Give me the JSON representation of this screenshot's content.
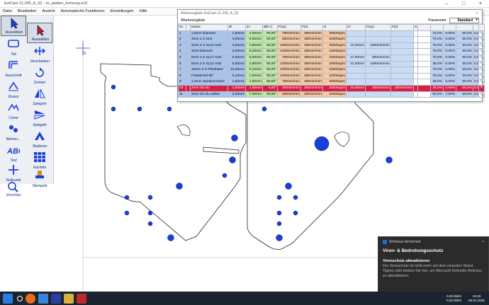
{
  "window": {
    "title": "EstCam 11.245_A_32 - xx_platten_bohrung.e10"
  },
  "menu": [
    "Datei",
    "Bearbeiten",
    "Ansicht",
    "Automatische Funktionen",
    "Einstellungen",
    "Hilfe"
  ],
  "tools": [
    {
      "label": "Auswählen",
      "icon": "select-arrow-icon"
    },
    {
      "label": "Auswählen",
      "icon": "select-arrow-icon"
    },
    {
      "label": "Teil",
      "icon": "part-icon"
    },
    {
      "label": "Verschieben",
      "icon": "move-icon"
    },
    {
      "label": "Ausschnitt",
      "icon": "cutout-icon"
    },
    {
      "label": "Drehen",
      "icon": "rotate-icon"
    },
    {
      "label": "Gravur",
      "icon": "engrave-icon"
    },
    {
      "label": "Spiegeln",
      "icon": "mirror-icon"
    },
    {
      "label": "Carve",
      "icon": "carve-icon"
    },
    {
      "label": "Spiegeln",
      "icon": "mirror-icon"
    },
    {
      "label": "Bohren...",
      "icon": "drill-icon"
    },
    {
      "label": "Skalieren",
      "icon": "scale-icon"
    },
    {
      "label": "Text",
      "icon": "text-icon"
    },
    {
      "label": "Kacheln",
      "icon": "tiles-icon"
    },
    {
      "label": "Nullpunkt",
      "icon": "origin-icon"
    },
    {
      "label": "Stempeln",
      "icon": "stamp-icon"
    },
    {
      "label": "Vorschau",
      "icon": "preview-icon"
    }
  ],
  "toolwindow": {
    "title": "Werkzeugliste EstCam 11.245_A_32",
    "subtitle": "Werkzeugliste",
    "param_label": "Parameter",
    "param_value": "Standard",
    "headers": [
      "Nr.",
      "Name",
      "Ø",
      "Z+",
      "Ø(z+)",
      "F(xy)",
      "F(z)",
      "S",
      "Z+",
      "F(xy)",
      "F(z)",
      "S",
      "",
      "",
      "",
      "",
      "",
      ""
    ],
    "rows": [
      [
        "1",
        "1,5mm Diamant",
        "1,50mm",
        "4,50mm",
        "90,00°",
        "750mm/min",
        "480mm/min",
        "30000upm",
        "",
        "",
        "",
        "",
        "75,0%",
        "0,00%",
        "50,0%",
        "0,00mm"
      ],
      [
        "2",
        "3mm 1 S SL9",
        "3,00mm",
        "6,00mm",
        "90,00°",
        "600mm/min",
        "480mm/min",
        "24000upm",
        "",
        "",
        "",
        "",
        "75,0%",
        "0,00%",
        "50,0%",
        "0,00mm"
      ],
      [
        "3",
        "3mm 2 S SL15 Holz",
        "3,00mm",
        "4,80mm",
        "90,00°",
        "1800mm/min",
        "480mm/min",
        "30000upm",
        "12,00mm",
        "1500mm/min",
        "",
        "",
        "75,0%",
        "0,00%",
        "50,0%",
        "0,00mm"
      ],
      [
        "4",
        "3mm Diamant",
        "3,00mm",
        "9,00mm",
        "90,00°",
        "2100mm/min",
        "480mm/min",
        "24000upm",
        "",
        "",
        "",
        "",
        "75,0%",
        "0,00%",
        "50,0%",
        "0,00mm"
      ],
      [
        "5",
        "6mm 1 S SL17 Holz",
        "6,00mm",
        "6,00mm",
        "90,00°",
        "750mm/min",
        "480mm/min",
        "24000upm",
        "17,00mm",
        "500mm/min",
        "",
        "",
        "70,0%",
        "0,00%",
        "50,0%",
        "0,00mm"
      ],
      [
        "6",
        "6mm 2 S SL21 Holz",
        "6,00mm",
        "4,80mm",
        "90,00°",
        "1000mm/min",
        "480mm/min",
        "20000upm",
        "21,00mm",
        "1500mm/min",
        "",
        "",
        "45,0%",
        "0,00%",
        "50,0%",
        "0,00mm"
      ],
      [
        "7",
        "10mm 3 S Planfräser",
        "10,00mm",
        "0,10mm",
        "90,00°",
        "2000mm/min",
        "480mm/min",
        "10000upm",
        "",
        "",
        "",
        "",
        "75,0%",
        "0,00%",
        "50,0%",
        "0,00mm"
      ],
      [
        "8",
        "Frässtichel 90°",
        "0,10mm",
        "1,00mm",
        "90,00°",
        "1000mm/min",
        "480mm/min",
        "24000upm",
        "",
        "",
        "",
        "",
        "75,0%",
        "0,00%",
        "50,0%",
        "0,00mm"
      ],
      [
        "9",
        "1,5mm Spiralverzahnt",
        "1,50mm",
        "1,50mm",
        "90,00°",
        "750mm/min",
        "480mm/min",
        "30000upm",
        "",
        "",
        "",
        "",
        "45,0%",
        "0,00%",
        "50,0%",
        "0,00mm"
      ],
      [
        "10",
        "3mm 2S Alu",
        "3,00mm",
        "1,50mm",
        "5,00°",
        "400mm/min",
        "300mm/min",
        "24000upm",
        "10,00mm",
        "300mm/min",
        "200mm/min",
        "",
        "25,0%",
        "0,00%",
        "50,0%",
        "0,00mm"
      ],
      [
        "11",
        "3mm 2S Alu wirbel",
        "3,00mm",
        "7,00mm",
        "90,00°",
        "400mm/min",
        "300mm/min",
        "24000upm",
        "",
        "",
        "",
        "",
        "60,0%",
        "7,00%",
        "50,0%",
        "0,00mm"
      ]
    ],
    "selected_row": 9
  },
  "canvas": {
    "origin_label": "0"
  },
  "toast": {
    "app": "Windows-Sicherheit",
    "heading": "Viren- & Bedrohungsschutz",
    "title": "Virenschutz aktualisieren",
    "body": "Der Virenschutz ist nicht mehr auf dem neuesten Stand. Tippen oder klicken Sie hier, um Microsoft Defender Antivirus zu aktualisieren."
  },
  "taskbar": {
    "net_up": "0,00 kbit/s",
    "net_down": "0,00 kbit/s",
    "time": "19:33",
    "date": "06.01.2025"
  },
  "colors": {
    "accent_blue": "#1a3fd8",
    "selected_red": "#d61f44",
    "toolbar_text": "#0a2a8c"
  }
}
